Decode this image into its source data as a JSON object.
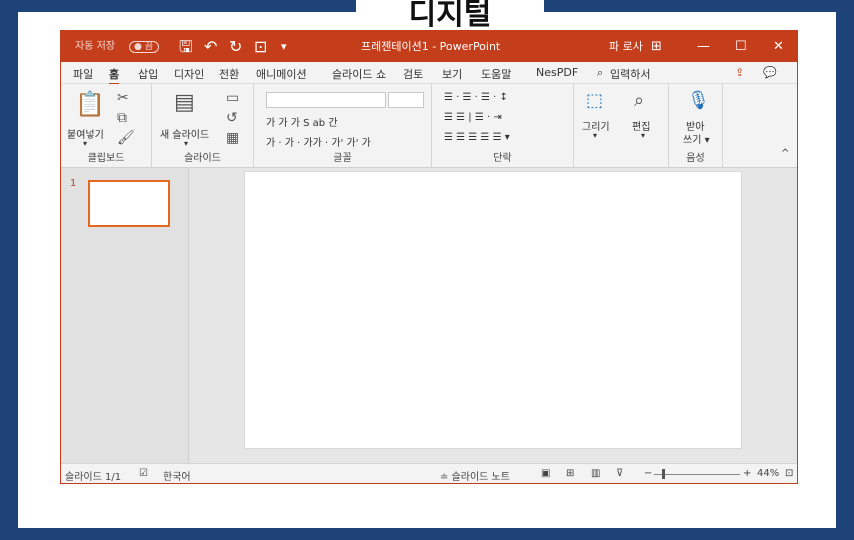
{
  "banner": {
    "text": "디지털"
  },
  "titlebar": {
    "autosave": "자동 저장",
    "autosave_state": "● 끔",
    "save_icon": "🖫",
    "undo_icon": "↶",
    "redo_icon": "↻",
    "present_icon": "⊡",
    "customize_icon": "▾",
    "title": "프레젠테이션1 - PowerPoint",
    "user": "파 로사",
    "ribbon_display_icon": "⊞",
    "minimize": "—",
    "maximize": "☐",
    "close": "✕"
  },
  "tabs": {
    "file": "파일",
    "home": "홈",
    "insert": "삽입",
    "design": "디자인",
    "transitions": "전환",
    "animations": "애니메이션",
    "slideshow": "슬라이드 쇼",
    "review": "검토",
    "view": "보기",
    "help": "도움말",
    "nespdf": "NesPDF",
    "search": "입력하서",
    "share_icon": "⇪",
    "comments_icon": "💬"
  },
  "ribbon": {
    "clipboard": {
      "label": "클립보드",
      "paste": "붙여넣기",
      "paste_arrow": "▾"
    },
    "slides": {
      "label": "슬라이드",
      "new_slide": "새 슬라이드",
      "new_slide_arrow": "▾"
    },
    "font": {
      "label": "글꼴",
      "row2": "가 가 가 S ab 간",
      "row3": "가 · 가 · 가가 · 가' 가' 가"
    },
    "paragraph": {
      "label": "단락",
      "row1": "☰ · ☰ · ☰ · ↕",
      "row2": "☰ ☰ | ☰ · ⇥",
      "row3": "☰ ☰ ☰ ☰ ☰ ▾"
    },
    "drawing": {
      "draw": "그리기",
      "edit": "편집",
      "draw_arrow": "▾",
      "edit_arrow": "▾"
    },
    "voice": {
      "label": "음성",
      "dictate_line1": "받아",
      "dictate_line2": "쓰기 ▾"
    },
    "collapse": "^"
  },
  "thumbs": {
    "number": "1"
  },
  "statusbar": {
    "slide": "슬라이드 1/1",
    "language": "한국어",
    "notes": "≐ 슬라이드 노트",
    "minus": "−",
    "plus": "+",
    "zoom": "44%",
    "zoom_percent": 44
  }
}
